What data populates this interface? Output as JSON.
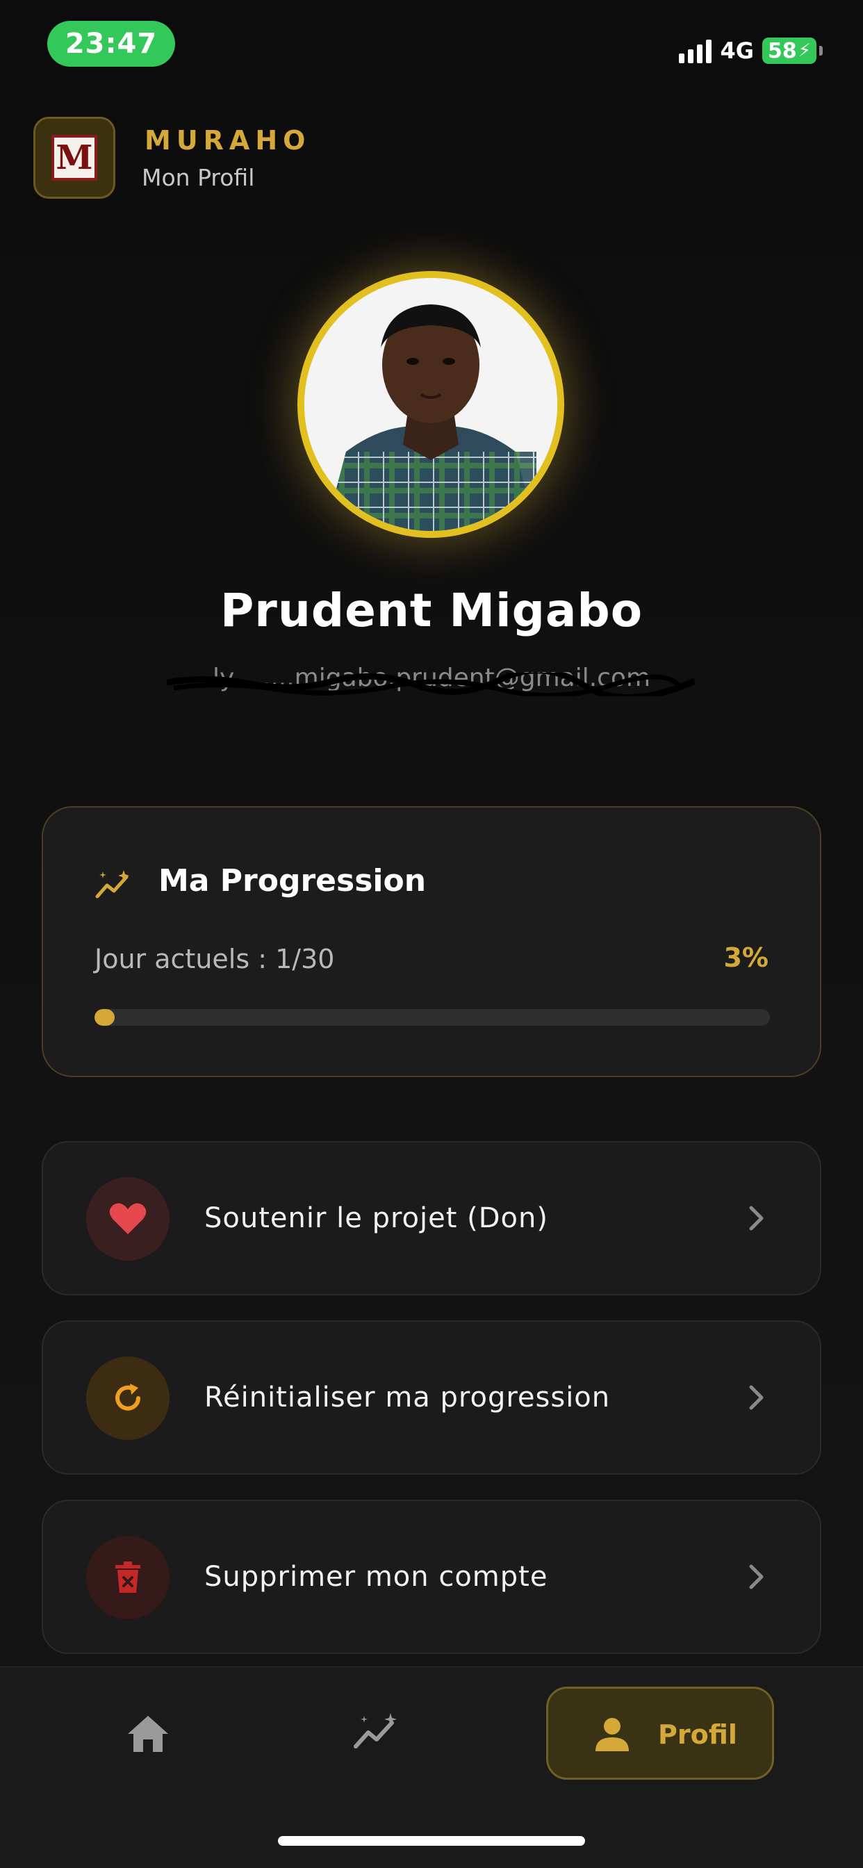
{
  "status_bar": {
    "time": "23:47",
    "network": "4G",
    "battery": "58"
  },
  "header": {
    "brand": "MURAHO",
    "subtitle": "Mon Profil",
    "logo_letter": "M"
  },
  "profile": {
    "name": "Prudent Migabo",
    "email": "ly........migabo.prudent@gmail.com"
  },
  "progression": {
    "title": "Ma Progression",
    "day_label": "Jour actuels : 1/30",
    "percent_label": "3%",
    "percent_value": 3
  },
  "actions": [
    {
      "label": "Soutenir le projet (Don)",
      "icon": "heart-icon",
      "color": "#e5484d"
    },
    {
      "label": "Réinitialiser ma progression",
      "icon": "refresh-icon",
      "color": "#f0a020"
    },
    {
      "label": "Supprimer mon compte",
      "icon": "trash-icon",
      "color": "#c62828"
    }
  ],
  "nav": {
    "items": [
      {
        "icon": "home-icon",
        "label": ""
      },
      {
        "icon": "progress-icon",
        "label": ""
      },
      {
        "icon": "user-icon",
        "label": "Profil"
      }
    ],
    "active": "Profil"
  },
  "colors": {
    "accent": "#d4a93a",
    "background": "#0e0e0e",
    "card": "#1c1c1c"
  }
}
